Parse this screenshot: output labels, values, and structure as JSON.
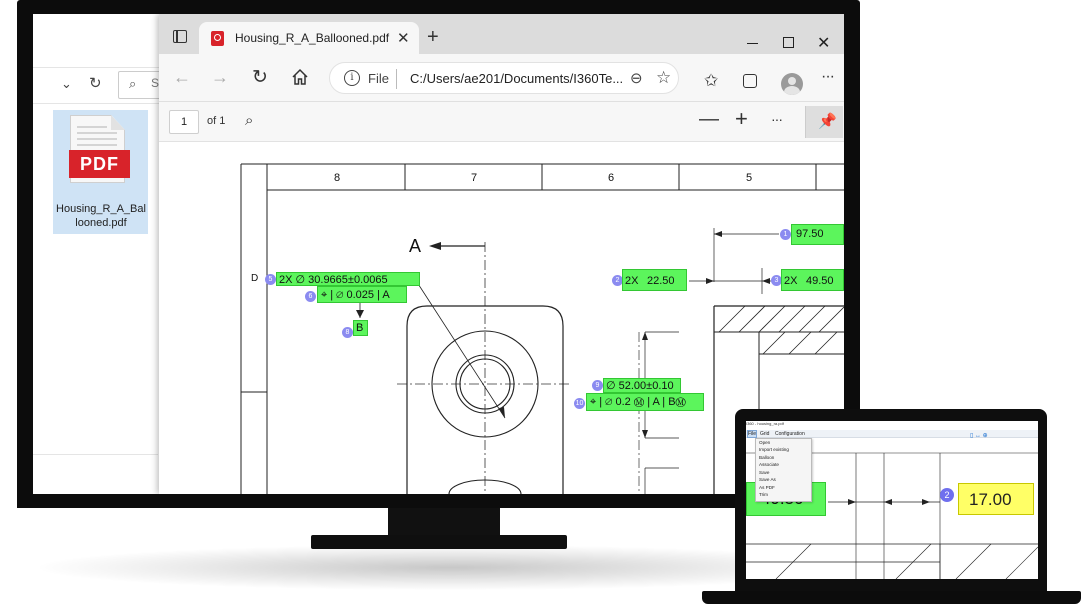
{
  "explorer": {
    "search_letter": "S",
    "file": {
      "badge": "PDF",
      "name": "Housing_R_A_Ballooned.pdf",
      "name_line1": "Housing_R_A_Bal",
      "name_line2": "looned.pdf"
    }
  },
  "browser": {
    "tab_title": "Housing_R_A_Ballooned.pdf",
    "address_scheme": "File",
    "address_url": "C:/Users/ae201/Documents/I360Te...",
    "pdf_toolbar": {
      "page_number": "1",
      "page_count": "of 1"
    }
  },
  "drawing": {
    "zone_labels": [
      "8",
      "7",
      "6",
      "5"
    ],
    "row_label": "D",
    "section_label": "A",
    "annotations": [
      {
        "balloon": "1",
        "text": "97.50"
      },
      {
        "balloon": "2",
        "text": "2X",
        "value": "22.50"
      },
      {
        "balloon": "3",
        "text": "2X",
        "value": "49.50"
      },
      {
        "balloon": "5",
        "text": "2X ∅ 30.9665±0.0065"
      },
      {
        "balloon": "6",
        "text": "⌖ | ∅ 0.025 | A"
      },
      {
        "balloon": "8",
        "text": "B"
      },
      {
        "balloon": "9",
        "text": "∅ 52.00±0.10"
      },
      {
        "balloon": "10",
        "text": "⌖ | ∅ 0.2 Ⓜ | A | BⓂ"
      }
    ]
  },
  "laptop": {
    "window_title": "I360 - housing_ra.pdf",
    "menu": [
      "File",
      "Grid",
      "Configuration"
    ],
    "file_menu_items": [
      "Open",
      "Import existing",
      "Balloon",
      "Associate",
      "Save",
      "Save As",
      "As PDF",
      "Trim"
    ],
    "balloon_number": "2",
    "highlighted_value": "17.00",
    "left_value": "49.50"
  }
}
